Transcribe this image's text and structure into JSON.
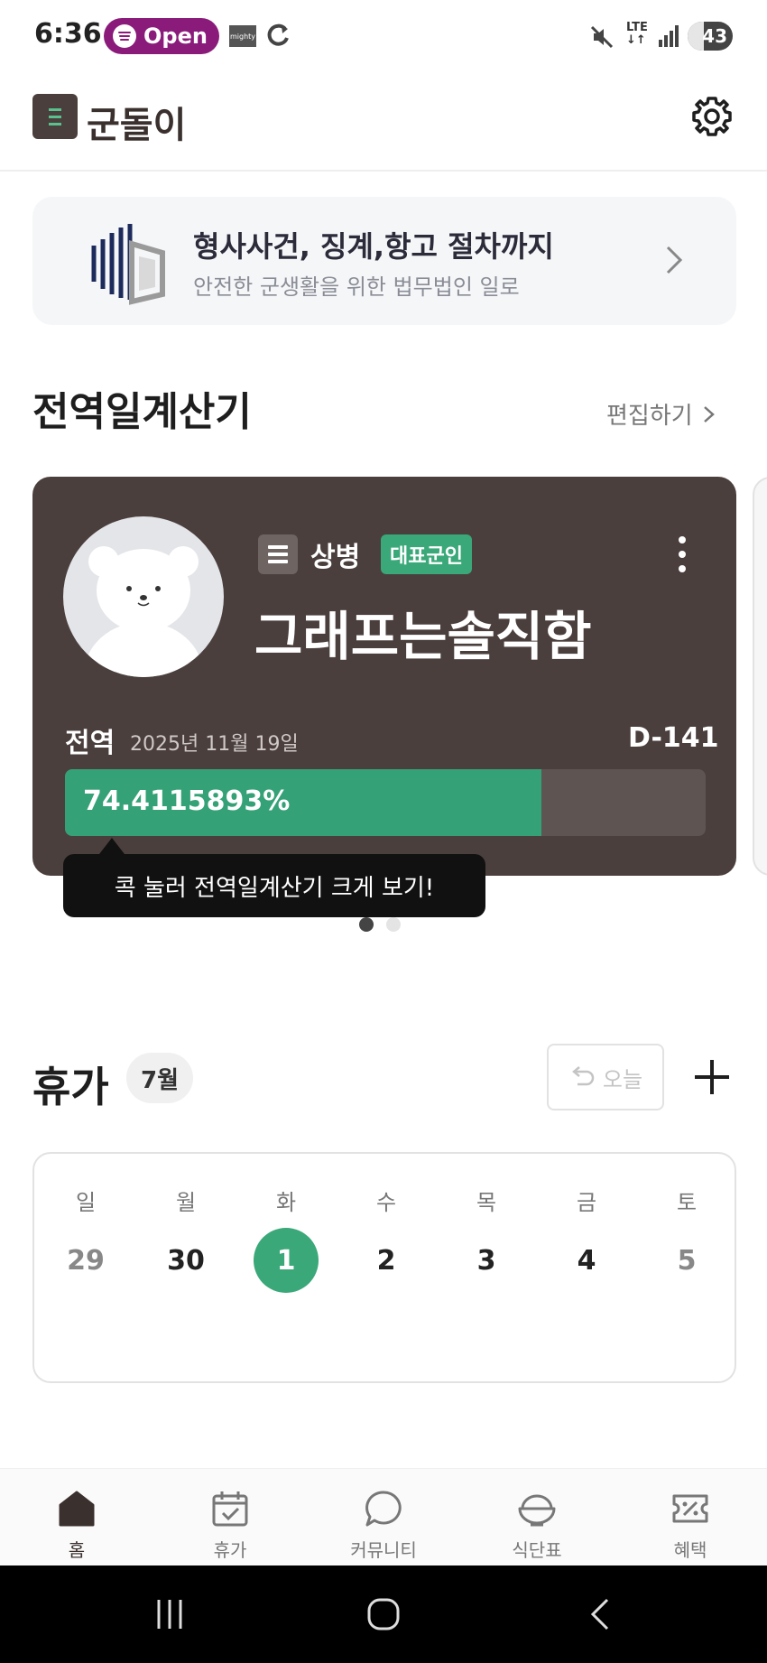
{
  "status_bar": {
    "time": "6:36",
    "spotify_label": "Open",
    "mighty_label": "mighty",
    "network": "LTE",
    "battery": "43"
  },
  "header": {
    "app_title": "군돌이"
  },
  "ad_banner": {
    "title": "형사사건, 징계,항고 절차까지",
    "subtitle": "안전한 군생활을 위한 법무법인 일로"
  },
  "discharge_section": {
    "title": "전역일계산기",
    "edit_label": "편집하기",
    "card": {
      "rank": "상병",
      "badge": "대표군인",
      "name": "그래프는솔직함",
      "discharge_label": "전역",
      "discharge_date": "2025년 11월 19일",
      "dday": "D-141",
      "progress_text": "74.4115893%",
      "progress_value": 74.4115893
    },
    "tooltip": "콕 눌러 전역일계산기 크게 보기!",
    "page_count": 2,
    "active_page": 0
  },
  "vacation_section": {
    "title": "휴가",
    "month": "7월",
    "today_label": "오늘",
    "week": [
      {
        "weekday": "일",
        "date": "29",
        "state": "muted"
      },
      {
        "weekday": "월",
        "date": "30",
        "state": "normal"
      },
      {
        "weekday": "화",
        "date": "1",
        "state": "selected"
      },
      {
        "weekday": "수",
        "date": "2",
        "state": "normal"
      },
      {
        "weekday": "목",
        "date": "3",
        "state": "normal"
      },
      {
        "weekday": "금",
        "date": "4",
        "state": "normal"
      },
      {
        "weekday": "토",
        "date": "5",
        "state": "muted"
      }
    ]
  },
  "bottom_nav": {
    "items": [
      {
        "label": "홈",
        "icon": "home-icon",
        "active": true
      },
      {
        "label": "휴가",
        "icon": "calendar-check-icon",
        "active": false
      },
      {
        "label": "커뮤니티",
        "icon": "chat-bubble-icon",
        "active": false
      },
      {
        "label": "식단표",
        "icon": "rice-bowl-icon",
        "active": false
      },
      {
        "label": "혜택",
        "icon": "coupon-icon",
        "active": false
      }
    ]
  },
  "colors": {
    "accent_green": "#3aa878",
    "card_brown": "#4a3f3d",
    "spotify_purple": "#8a1b7a"
  }
}
